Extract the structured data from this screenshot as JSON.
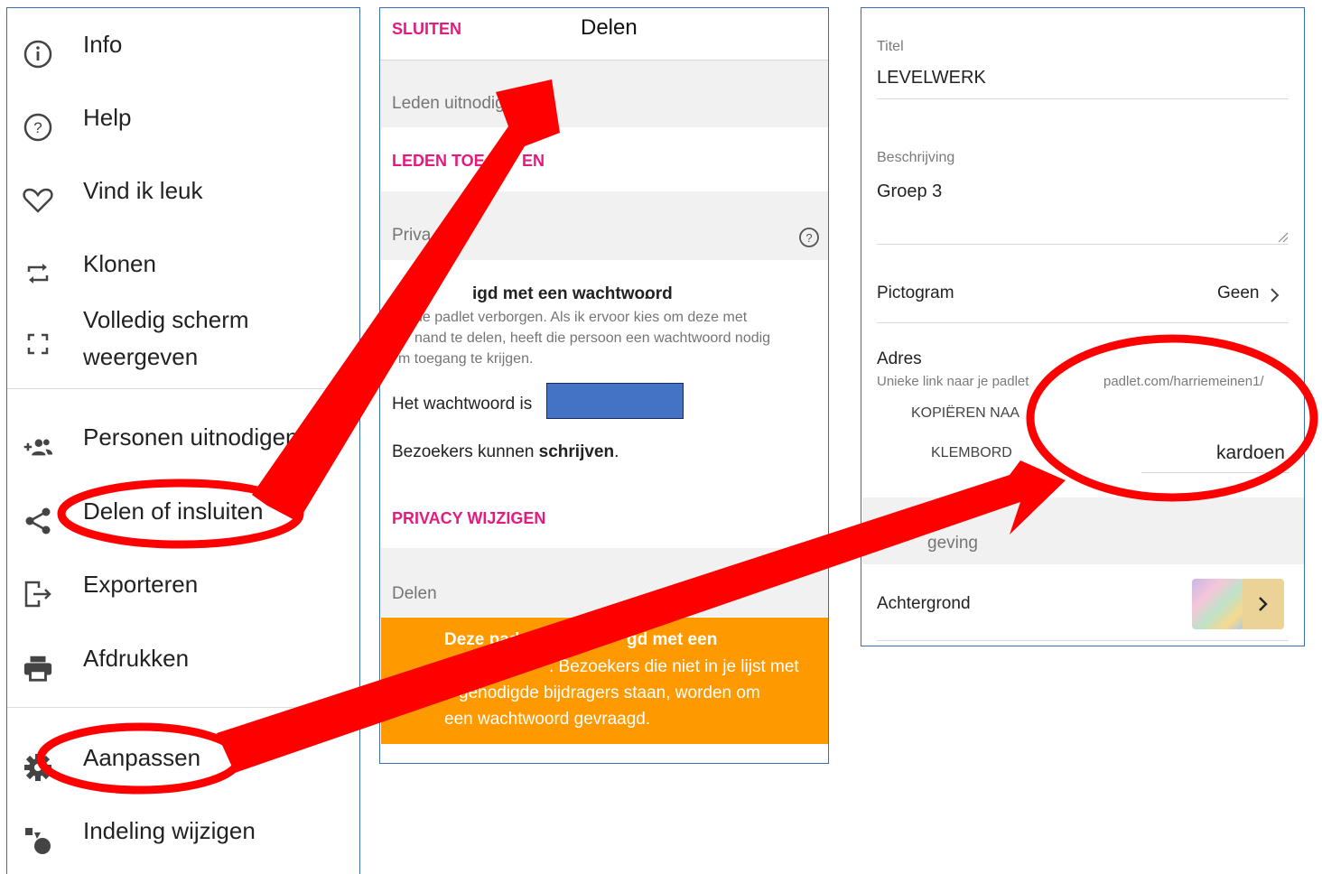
{
  "menu": {
    "items": [
      {
        "label": "Info",
        "icon": "info-icon"
      },
      {
        "label": "Help",
        "icon": "help-icon"
      },
      {
        "label": "Vind ik leuk",
        "icon": "heart-icon"
      },
      {
        "label": "Klonen",
        "icon": "repeat-icon"
      },
      {
        "label": "Volledig scherm",
        "label2": "weergeven",
        "icon": "fullscreen-icon"
      },
      {
        "label": "Personen uitnodigen",
        "icon": "add-people-icon"
      },
      {
        "label": "Delen of insluiten",
        "icon": "share-icon"
      },
      {
        "label": "Exporteren",
        "icon": "export-icon"
      },
      {
        "label": "Afdrukken",
        "icon": "print-icon"
      },
      {
        "label": "Aanpassen",
        "icon": "gear-icon"
      },
      {
        "label": "Indeling wijzigen",
        "icon": "layout-icon"
      }
    ]
  },
  "share": {
    "close_label": "SLUITEN",
    "title": "Delen",
    "invite_section": "Leden uitnodig",
    "add_members": "LEDEN TOE",
    "add_members_tail": "EN",
    "privacy_section": "Priva",
    "privacy_heading_part": "igd met een wachtwoord",
    "privacy_heading_dot": ".",
    "privacy_desc_1": "de padlet verborgen. Als ik ervoor kies om deze met",
    "privacy_desc_2": "nand te delen, heeft die persoon een wachtwoord nodig",
    "privacy_desc_3": "m toegang te krijgen.",
    "password_label": "Het wachtwoord is",
    "visitors_prefix": "Bezoekers kunnen ",
    "visitors_bold": "schrijven",
    "visitors_suffix": ".",
    "change_privacy": "PRIVACY WIJZIGEN",
    "share_section": "Delen",
    "warning_bold_1": "Deze pad",
    "warning_bold_2": "gd met een",
    "warning_text_1": ". Bezoekers die niet in je lijst met",
    "warning_text_2": "genodigde bijdragers staan, worden om",
    "warning_text_3": "een wachtwoord gevraagd."
  },
  "custom": {
    "title_label": "Titel",
    "title_value": "LEVELWERK",
    "desc_label": "Beschrijving",
    "desc_value": "Groep 3",
    "icon_label": "Pictogram",
    "icon_value": "Geen",
    "address_label": "Adres",
    "address_hint": "Unieke link naar je padlet",
    "address_prefix": "padlet.com/harriemeinen1/",
    "copy_label_1": "KOPIËREN NAA",
    "copy_label_2": "KLEMBORD",
    "address_value": "kardoen",
    "appearance_section": "geving",
    "background_label": "Achtergrond"
  },
  "colors": {
    "accent_pink": "#e6197e",
    "warning_orange": "#ff9900",
    "annotation_red": "#ff0000",
    "border_blue": "#3b6bb0",
    "password_fill": "#4472c4"
  }
}
